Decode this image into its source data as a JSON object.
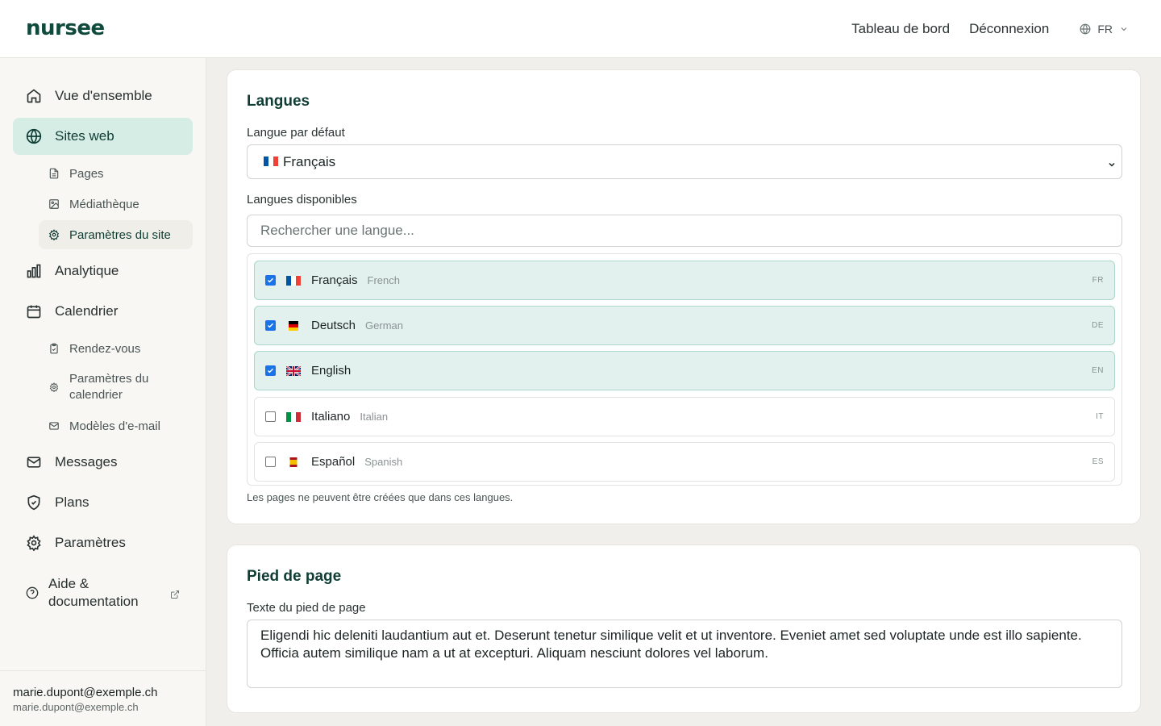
{
  "header": {
    "logo": "nursee",
    "nav": [
      "Tableau de bord",
      "Déconnexion"
    ],
    "lang_code": "FR"
  },
  "sidebar": {
    "items": [
      {
        "label": "Vue d'ensemble",
        "icon": "home-icon"
      },
      {
        "label": "Sites web",
        "icon": "globe-icon",
        "active": true
      },
      {
        "label": "Analytique",
        "icon": "bar-chart-icon"
      },
      {
        "label": "Calendrier",
        "icon": "calendar-icon"
      },
      {
        "label": "Messages",
        "icon": "mail-icon"
      },
      {
        "label": "Plans",
        "icon": "shield-icon"
      },
      {
        "label": "Paramètres",
        "icon": "gear-icon"
      },
      {
        "label": "Aide & documentation",
        "icon": "help-circle-icon"
      }
    ],
    "sites_sub": [
      {
        "label": "Pages",
        "icon": "file-icon"
      },
      {
        "label": "Médiathèque",
        "icon": "image-icon"
      },
      {
        "label": "Paramètres du site",
        "icon": "gear-icon",
        "active": true
      }
    ],
    "calendar_sub": [
      {
        "label": "Rendez-vous",
        "icon": "clipboard-icon"
      },
      {
        "label": "Paramètres du calendrier",
        "icon": "gear-icon"
      },
      {
        "label": "Modèles d'e-mail",
        "icon": "mail-icon"
      }
    ],
    "user": {
      "name": "marie.dupont@exemple.ch",
      "email": "marie.dupont@exemple.ch"
    }
  },
  "languages_card": {
    "title": "Langues",
    "default_label": "Langue par défaut",
    "default_value": "Français",
    "available_label": "Langues disponibles",
    "search_placeholder": "Rechercher une langue...",
    "languages": [
      {
        "native": "Français",
        "english": "French",
        "code": "FR",
        "checked": true,
        "flag": "fr"
      },
      {
        "native": "Deutsch",
        "english": "German",
        "code": "DE",
        "checked": true,
        "flag": "de"
      },
      {
        "native": "English",
        "english": "",
        "code": "EN",
        "checked": true,
        "flag": "gb"
      },
      {
        "native": "Italiano",
        "english": "Italian",
        "code": "IT",
        "checked": false,
        "flag": "it"
      },
      {
        "native": "Español",
        "english": "Spanish",
        "code": "ES",
        "checked": false,
        "flag": "es"
      }
    ],
    "hint": "Les pages ne peuvent être créées que dans ces langues."
  },
  "footer_card": {
    "title": "Pied de page",
    "text_label": "Texte du pied de page",
    "text_value": "Eligendi hic deleniti laudantium aut et. Deserunt tenetur similique velit et ut inventore. Eveniet amet sed voluptate unde est illo sapiente. Officia autem similique nam a ut at excepturi. Aliquam nesciunt dolores vel laborum."
  },
  "colors": {
    "brand": "#0f4a3c",
    "active_bg": "#d6ede6",
    "selected_row_bg": "#e2f1ed",
    "checkbox": "#1a73e8"
  }
}
